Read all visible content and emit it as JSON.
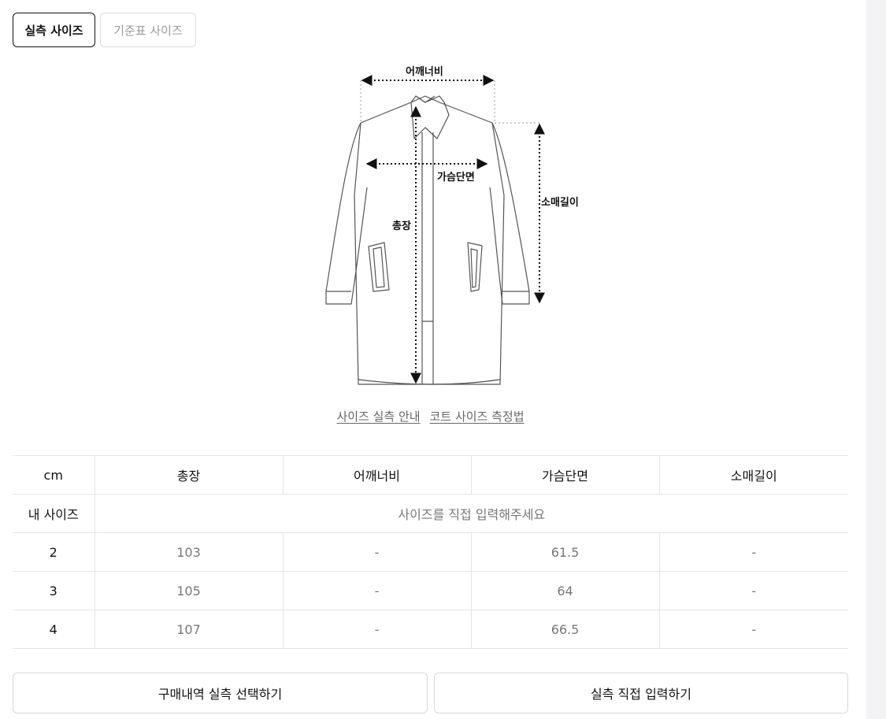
{
  "tabs": {
    "actual": "실측 사이즈",
    "standard": "기준표 사이즈"
  },
  "diagram": {
    "shoulder_label": "어깨너비",
    "chest_label": "가슴단면",
    "length_label": "총장",
    "sleeve_label": "소매길이"
  },
  "links": {
    "guide": "사이즈 실측 안내",
    "method": "코트 사이즈 측정법"
  },
  "table": {
    "unit": "cm",
    "headers": [
      "총장",
      "어깨너비",
      "가슴단면",
      "소매길이"
    ],
    "my_size_label": "내 사이즈",
    "my_size_hint": "사이즈를 직접 입력해주세요",
    "rows": [
      {
        "size": "2",
        "values": [
          "103",
          "-",
          "61.5",
          "-"
        ]
      },
      {
        "size": "3",
        "values": [
          "105",
          "-",
          "64",
          "-"
        ]
      },
      {
        "size": "4",
        "values": [
          "107",
          "-",
          "66.5",
          "-"
        ]
      }
    ]
  },
  "buttons": {
    "purchase": "구매내역 실측 선택하기",
    "manual": "실측 직접 입력하기"
  }
}
